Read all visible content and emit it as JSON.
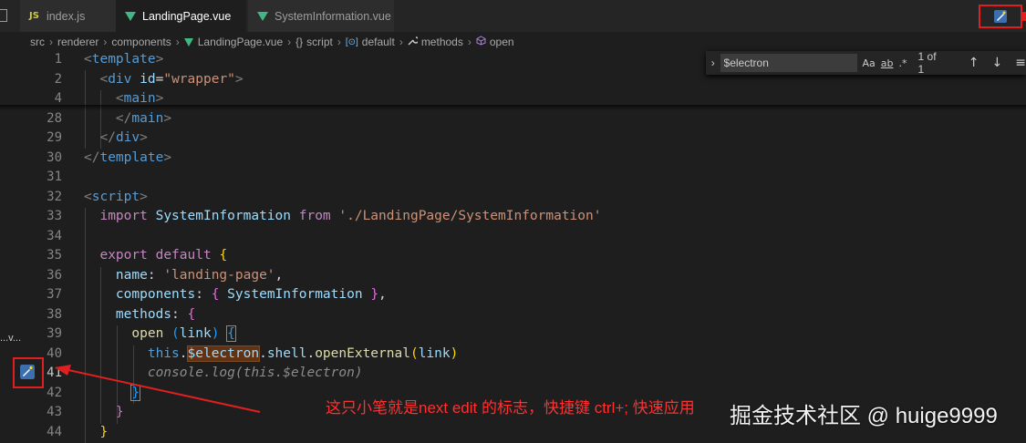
{
  "tabs": [
    {
      "label": "index.js",
      "icon": "js-icon"
    },
    {
      "label": "LandingPage.vue",
      "icon": "vue-icon",
      "dirty": true,
      "active": true
    },
    {
      "label": "SystemInformation.vue",
      "icon": "vue-icon"
    }
  ],
  "breadcrumb": {
    "items": [
      "src",
      "renderer",
      "components",
      "LandingPage.vue",
      "script",
      "default",
      "methods",
      "open"
    ],
    "script_prefix": "{}",
    "default_prefix": "[⊙]"
  },
  "find": {
    "value": "$electron",
    "match_case": "Aa",
    "whole_word": "ab",
    "regex": ".*",
    "count": "1 of 1"
  },
  "sidebar": {
    "truncated_label": "...v..."
  },
  "line_numbers": [
    "1",
    "2",
    "4",
    "28",
    "29",
    "30",
    "31",
    "32",
    "33",
    "34",
    "35",
    "36",
    "37",
    "38",
    "39",
    "40",
    "41",
    "42",
    "43",
    "44"
  ],
  "code": {
    "l1_open": "<",
    "l1_tag": "template",
    "l1_close": ">",
    "l2_div": "div",
    "l2_attr": "id",
    "l2_eq": "=",
    "l2_str": "\"wrapper\"",
    "l4_tag": "main",
    "l28_tag": "main",
    "l29_tag": "div",
    "l30_tag": "template",
    "l32_tag": "script",
    "l33_import": "import",
    "l33_cls": "SystemInformation",
    "l33_from": "from",
    "l33_str": "'./LandingPage/SystemInformation'",
    "l35_export": "export",
    "l35_default": "default",
    "l36_key": "name",
    "l36_str": "'landing-page'",
    "l37_key": "components",
    "l37_cls": "SystemInformation",
    "l38_key": "methods",
    "l39_fn": "open",
    "l39_param": "link",
    "l40_this": "this",
    "l40_elec": "$electron",
    "l40_shell": "shell",
    "l40_fn": "openExternal",
    "l40_arg": "link",
    "l41_ghost": "console.log(this.$electron)"
  },
  "annotation": "这只小笔就是next edit 的标志，快捷键 ctrl+; 快速应用",
  "watermark": "掘金技术社区 @ huige9999",
  "colors": {
    "accent_red": "#e02020",
    "copilot_blue": "#3b6fb0"
  }
}
